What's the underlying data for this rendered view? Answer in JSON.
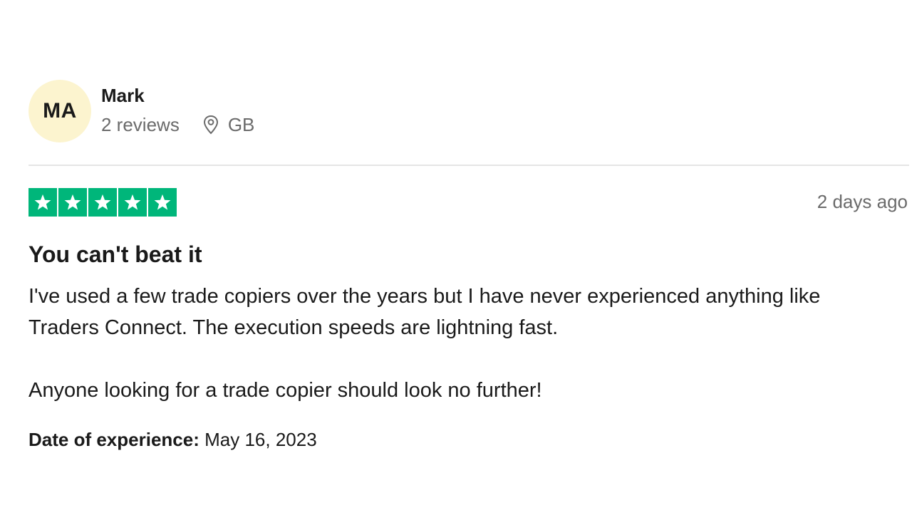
{
  "consumer": {
    "initials": "MA",
    "name": "Mark",
    "reviews_count": "2 reviews",
    "location_icon": "location-pin-icon",
    "country": "GB",
    "avatar_color": "#fcf4cf"
  },
  "review": {
    "rating": 5,
    "max_rating": 5,
    "star_color": "#00b67a",
    "date": "2 days ago",
    "title": "You can't beat it",
    "paragraphs": [
      "I've used a few trade copiers over the years but I have never experienced anything like Traders Connect. The execution speeds are lightning fast.",
      "Anyone looking for a trade copier should look no further!"
    ],
    "experience_label": "Date of experience:",
    "experience_date": "May 16, 2023"
  }
}
